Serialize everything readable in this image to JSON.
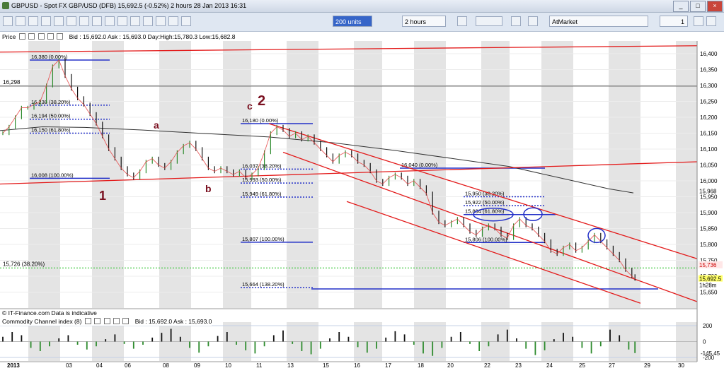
{
  "window": {
    "title": "GBPUSD - Spot FX GBP/USD (DFB)    15,692.5 (-0.52%)    2 hours    28 Jan 2013 16:31"
  },
  "toolbar": {
    "units": "200 units",
    "interval": "2 hours",
    "order_type": "AtMarket",
    "qty": "1"
  },
  "price_panel": {
    "label": "Price",
    "info": "Bid : 15,692.0 Ask : 15,693.0 Day:High:15,780.3 Low:15,682.8",
    "footer": "© IT-Finance.com  Data is indicative"
  },
  "cci_panel": {
    "label": "Commodity Channel index (8)",
    "info": "Bid : 15,692.0 Ask : 15,693.0",
    "scale": [
      "200",
      "0",
      "-200"
    ],
    "last_value": "-145.45"
  },
  "colors": {
    "up": "#2e8b2e",
    "channel": "#e31b1b",
    "fib": "#2330c8",
    "ema": "#e54545",
    "ma": "#333333",
    "wave": "#7a1020"
  },
  "chart_data": {
    "type": "line",
    "y_range": [
      15600,
      16440
    ],
    "y_ticks": [
      "16,400",
      "16,350",
      "16,300",
      "16,250",
      "16,200",
      "16,150",
      "16,100",
      "16,050",
      "16,000",
      "15,950",
      "15,900",
      "15,850",
      "15,800",
      "15,750",
      "15,700",
      "15,650"
    ],
    "price_tags": {
      "last": "15,692.5",
      "time_left": "1h28m",
      "level_a": "15,968",
      "level_b": "15,736"
    },
    "x_labels": [
      "2013",
      "03",
      "04",
      "06",
      "08",
      "09",
      "10",
      "11",
      "13",
      "15",
      "16",
      "17",
      "18",
      "20",
      "22",
      "23",
      "24",
      "25",
      "27",
      "29",
      "30"
    ],
    "price": [
      [
        0,
        16150
      ],
      [
        4,
        16170
      ],
      [
        8,
        16200
      ],
      [
        12,
        16230
      ],
      [
        16,
        16230
      ],
      [
        20,
        16240
      ],
      [
        24,
        16250
      ],
      [
        28,
        16300
      ],
      [
        32,
        16360
      ],
      [
        36,
        16380
      ],
      [
        40,
        16330
      ],
      [
        44,
        16290
      ],
      [
        48,
        16260
      ],
      [
        52,
        16240
      ],
      [
        56,
        16210
      ],
      [
        60,
        16180
      ],
      [
        64,
        16140
      ],
      [
        68,
        16100
      ],
      [
        72,
        16070
      ],
      [
        76,
        16040
      ],
      [
        80,
        16020
      ],
      [
        84,
        16010
      ],
      [
        88,
        16030
      ],
      [
        92,
        16060
      ],
      [
        96,
        16070
      ],
      [
        100,
        16050
      ],
      [
        104,
        16040
      ],
      [
        108,
        16060
      ],
      [
        112,
        16090
      ],
      [
        116,
        16110
      ],
      [
        120,
        16120
      ],
      [
        124,
        16100
      ],
      [
        128,
        16070
      ],
      [
        132,
        16040
      ],
      [
        136,
        16030
      ],
      [
        140,
        16040
      ],
      [
        144,
        16030
      ],
      [
        148,
        16020
      ],
      [
        152,
        16030
      ],
      [
        156,
        16010
      ],
      [
        160,
        16020
      ],
      [
        164,
        16040
      ],
      [
        168,
        16090
      ],
      [
        172,
        16150
      ],
      [
        176,
        16170
      ],
      [
        180,
        16160
      ],
      [
        184,
        16140
      ],
      [
        188,
        16150
      ],
      [
        192,
        16130
      ],
      [
        196,
        16140
      ],
      [
        200,
        16120
      ],
      [
        204,
        16100
      ],
      [
        208,
        16080
      ],
      [
        212,
        16060
      ],
      [
        216,
        16080
      ],
      [
        220,
        16090
      ],
      [
        224,
        16080
      ],
      [
        228,
        16060
      ],
      [
        232,
        16050
      ],
      [
        236,
        16030
      ],
      [
        240,
        16000
      ],
      [
        244,
        15990
      ],
      [
        248,
        16010
      ],
      [
        252,
        16020
      ],
      [
        256,
        16010
      ],
      [
        260,
        15990
      ],
      [
        264,
        16000
      ],
      [
        268,
        15980
      ],
      [
        272,
        15960
      ],
      [
        276,
        15900
      ],
      [
        280,
        15870
      ],
      [
        284,
        15860
      ],
      [
        288,
        15870
      ],
      [
        292,
        15880
      ],
      [
        296,
        15860
      ],
      [
        300,
        15840
      ],
      [
        304,
        15830
      ],
      [
        308,
        15850
      ],
      [
        312,
        15860
      ],
      [
        316,
        15850
      ],
      [
        320,
        15830
      ],
      [
        324,
        15820
      ],
      [
        328,
        15860
      ],
      [
        332,
        15880
      ],
      [
        336,
        15860
      ],
      [
        340,
        15850
      ],
      [
        344,
        15830
      ],
      [
        348,
        15810
      ],
      [
        352,
        15780
      ],
      [
        356,
        15770
      ],
      [
        360,
        15790
      ],
      [
        364,
        15800
      ],
      [
        368,
        15780
      ],
      [
        372,
        15790
      ],
      [
        376,
        15810
      ],
      [
        380,
        15830
      ],
      [
        384,
        15810
      ],
      [
        388,
        15790
      ],
      [
        392,
        15770
      ],
      [
        396,
        15750
      ],
      [
        400,
        15720
      ],
      [
        404,
        15700
      ],
      [
        406,
        15692
      ]
    ],
    "cci": [
      [
        0,
        60
      ],
      [
        6,
        120
      ],
      [
        12,
        80
      ],
      [
        18,
        -80
      ],
      [
        24,
        -120
      ],
      [
        30,
        -60
      ],
      [
        36,
        40
      ],
      [
        42,
        80
      ],
      [
        48,
        -40
      ],
      [
        54,
        -100
      ],
      [
        60,
        -60
      ],
      [
        66,
        30
      ],
      [
        72,
        90
      ],
      [
        78,
        -30
      ],
      [
        84,
        -90
      ],
      [
        90,
        -40
      ],
      [
        96,
        50
      ],
      [
        102,
        110
      ],
      [
        108,
        160
      ],
      [
        114,
        60
      ],
      [
        120,
        -80
      ],
      [
        126,
        -140
      ],
      [
        132,
        -60
      ],
      [
        138,
        70
      ],
      [
        144,
        120
      ],
      [
        150,
        -40
      ],
      [
        156,
        -110
      ],
      [
        162,
        -150
      ],
      [
        168,
        -60
      ],
      [
        174,
        80
      ],
      [
        180,
        140
      ],
      [
        186,
        -30
      ],
      [
        192,
        -120
      ],
      [
        198,
        -160
      ],
      [
        204,
        -90
      ],
      [
        210,
        40
      ],
      [
        216,
        120
      ],
      [
        222,
        60
      ],
      [
        228,
        -70
      ],
      [
        234,
        -140
      ],
      [
        240,
        -90
      ],
      [
        246,
        50
      ],
      [
        252,
        130
      ],
      [
        258,
        90
      ],
      [
        264,
        -40
      ],
      [
        270,
        -150
      ],
      [
        276,
        -180
      ],
      [
        282,
        -80
      ],
      [
        288,
        60
      ],
      [
        294,
        120
      ],
      [
        300,
        -30
      ],
      [
        306,
        -120
      ],
      [
        312,
        -60
      ],
      [
        318,
        90
      ],
      [
        324,
        150
      ],
      [
        330,
        40
      ],
      [
        336,
        -90
      ],
      [
        342,
        -170
      ],
      [
        348,
        -110
      ],
      [
        354,
        30
      ],
      [
        360,
        110
      ],
      [
        366,
        60
      ],
      [
        372,
        -80
      ],
      [
        378,
        -150
      ],
      [
        384,
        -60
      ],
      [
        390,
        150
      ],
      [
        396,
        80
      ],
      [
        402,
        -100
      ],
      [
        406,
        -145
      ]
    ],
    "fib_levels": [
      {
        "label": "16,380 (0.00%)",
        "value": 16380
      },
      {
        "label": "16,238 (38.20%)",
        "value": 16238
      },
      {
        "label": "16,194 (50.00%)",
        "value": 16194
      },
      {
        "label": "16,150 (61.80%)",
        "value": 16150
      },
      {
        "label": "16,008 (100.00%)",
        "value": 16008
      },
      {
        "label": "16,180 (0.00%)",
        "value": 16180
      },
      {
        "label": "16,037 (38.20%)",
        "value": 16037
      },
      {
        "label": "15,993 (50.00%)",
        "value": 15993
      },
      {
        "label": "15,949 (61.80%)",
        "value": 15949
      },
      {
        "label": "15,807 (100.00%)",
        "value": 15807
      },
      {
        "label": "15,664 (138.20%)",
        "value": 15664
      },
      {
        "label": "16,040 (0.00%)",
        "value": 16040
      },
      {
        "label": "15,950 (38.20%)",
        "value": 15950
      },
      {
        "label": "15,922 (50.00%)",
        "value": 15922
      },
      {
        "label": "15,894 (61.80%)",
        "value": 15894
      },
      {
        "label": "15,806 (100.00%)",
        "value": 15806
      }
    ],
    "annotations": [
      "16,298",
      "15,726 (38.20%)",
      "1",
      "a",
      "b",
      "c",
      "2"
    ]
  }
}
